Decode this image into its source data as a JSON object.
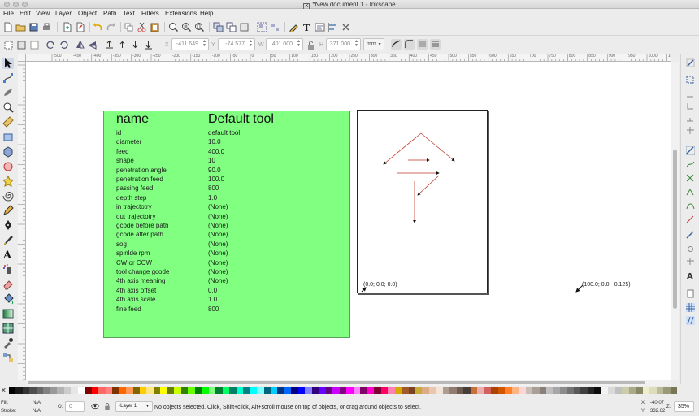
{
  "window": {
    "title": "*New document 1 - Inkscape"
  },
  "menu": [
    "File",
    "Edit",
    "View",
    "Layer",
    "Object",
    "Path",
    "Text",
    "Filters",
    "Extensions",
    "Help"
  ],
  "toolbar2": {
    "x_label": "X",
    "x_value": "-411.649",
    "y_label": "Y",
    "y_value": "-74.577",
    "w_label": "W",
    "w_value": "401.000",
    "h_label": "H",
    "h_value": "371.000",
    "unit": "mm"
  },
  "ruler": {
    "top_labels": [
      "-500",
      "-450",
      "-400",
      "-350",
      "-300",
      "-250",
      "-200",
      "-150",
      "-100",
      "-50",
      "0",
      "50",
      "100",
      "150",
      "200",
      "250",
      "300",
      "350",
      "400",
      "450",
      "500",
      "550",
      "600",
      "650",
      "700",
      "750",
      "800",
      "850",
      "900",
      "950",
      "1000",
      "1050",
      "1100",
      "1150",
      "1200"
    ]
  },
  "tool_table": {
    "header": {
      "name": "name",
      "value": "Default tool"
    },
    "rows": [
      {
        "key": "id",
        "value": "default tool"
      },
      {
        "key": "diameter",
        "value": "10.0"
      },
      {
        "key": "feed",
        "value": "400.0"
      },
      {
        "key": "shape",
        "value": "10"
      },
      {
        "key": "penetration angle",
        "value": "90.0"
      },
      {
        "key": "penetration feed",
        "value": "100.0"
      },
      {
        "key": "passing feed",
        "value": "800"
      },
      {
        "key": "depth step",
        "value": "1.0"
      },
      {
        "key": "in trajectotry",
        "value": "(None)"
      },
      {
        "key": "out trajectotry",
        "value": "(None)"
      },
      {
        "key": "gcode before path",
        "value": "(None)"
      },
      {
        "key": "gcode after path",
        "value": "(None)"
      },
      {
        "key": "sog",
        "value": "(None)"
      },
      {
        "key": "spinlde rpm",
        "value": "(None)"
      },
      {
        "key": "CW or CCW",
        "value": "(None)"
      },
      {
        "key": "tool change gcode",
        "value": "(None)"
      },
      {
        "key": "4th axis meaning",
        "value": "(None)"
      },
      {
        "key": "4th axis offset",
        "value": "0.0"
      },
      {
        "key": "4th axis scale",
        "value": "1.0"
      },
      {
        "key": "fine feed",
        "value": "800"
      }
    ]
  },
  "orientation_points": {
    "origin": "(0.0; 0.0; 0.0)",
    "point2": "(100.0; 0.0; -0.125)"
  },
  "colors": {
    "card_fill": "#80ff80",
    "path_stroke": "#c0392b",
    "canvas": "#ffffff",
    "chrome": "#ececec"
  },
  "status": {
    "fill_label": "Fill:",
    "fill_value": "N/A",
    "stroke_label": "Stroke:",
    "stroke_value": "N/A",
    "opacity_label": "O:",
    "opacity_value": "0",
    "layer": "•Layer 1",
    "message": "No objects selected. Click, Shift+click, Alt+scroll mouse on top of objects, or drag around objects to select.",
    "x_label": "X:",
    "x_value": "-40.07",
    "y_label": "Y:",
    "y_value": "332.62",
    "zoom_label": "Z:",
    "zoom_value": "35%"
  }
}
